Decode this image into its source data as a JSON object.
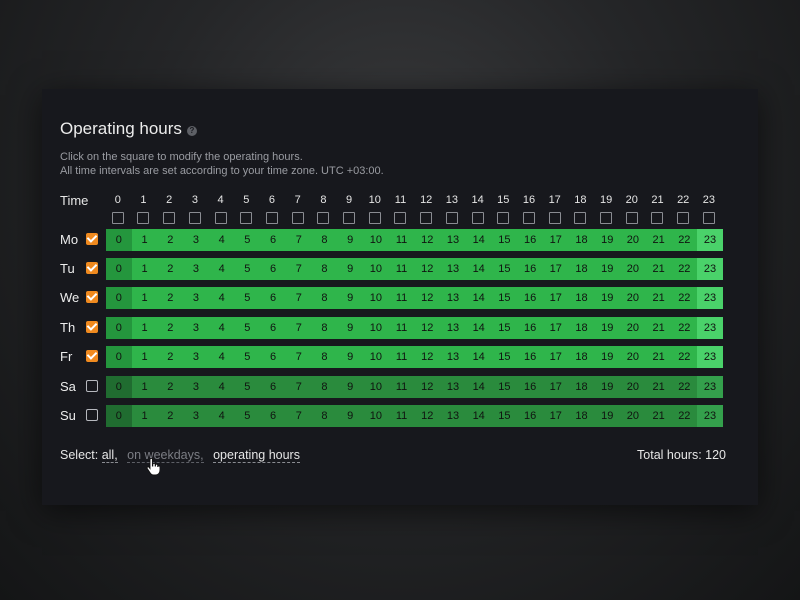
{
  "panel": {
    "title": "Operating hours",
    "help_icon": "question-circle-icon",
    "description_line1": "Click on the square to modify the operating hours.",
    "description_line2": "All time intervals are set according to your time zone. UTC +03:00."
  },
  "grid": {
    "time_label": "Time",
    "hours": [
      "0",
      "1",
      "2",
      "3",
      "4",
      "5",
      "6",
      "7",
      "8",
      "9",
      "10",
      "11",
      "12",
      "13",
      "14",
      "15",
      "16",
      "17",
      "18",
      "19",
      "20",
      "21",
      "22",
      "23"
    ],
    "days": [
      {
        "label": "Mo",
        "checked": true
      },
      {
        "label": "Tu",
        "checked": true
      },
      {
        "label": "We",
        "checked": true
      },
      {
        "label": "Th",
        "checked": true
      },
      {
        "label": "Fr",
        "checked": true
      },
      {
        "label": "Sa",
        "checked": false
      },
      {
        "label": "Su",
        "checked": false
      }
    ]
  },
  "footer": {
    "select_label": "Select:",
    "all_link": "all,",
    "weekdays_link": "on weekdays,",
    "operating_link": "operating hours",
    "total_label": "Total hours: 120"
  },
  "colors": {
    "accent_orange": "#f08a1f",
    "active_green": "#2fb54b",
    "inactive_green": "#2a8b3d",
    "panel_bg": "#17181d"
  },
  "cursor_icon": "hand-pointer-icon"
}
